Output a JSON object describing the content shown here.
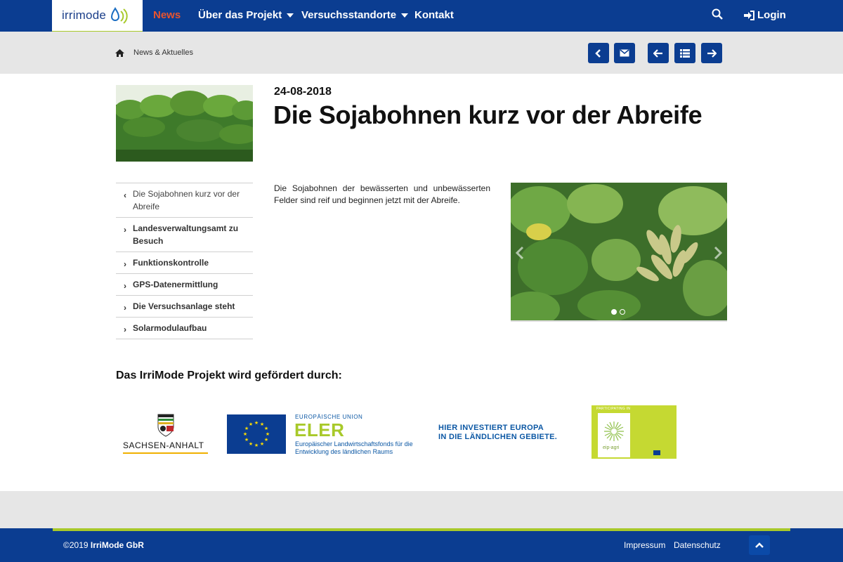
{
  "header": {
    "logo_text": "irrimode",
    "nav": [
      {
        "label": "News"
      },
      {
        "label": "Über das Projekt"
      },
      {
        "label": "Versuchsstandorte"
      },
      {
        "label": "Kontakt"
      }
    ],
    "login_label": "Login",
    "icons": {
      "search": "search-icon",
      "login": "sign-in-icon"
    },
    "colors": {
      "primary": "#0b3d91",
      "accent": "#a8c92a",
      "active": "#e8542e"
    }
  },
  "breadcrumb": {
    "label": "News & Aktuelles",
    "icons": [
      "home-icon"
    ]
  },
  "toolbar": {
    "buttons": [
      "chevron-left-icon",
      "envelope-icon",
      "arrow-left-icon",
      "list-icon",
      "arrow-right-icon"
    ]
  },
  "article": {
    "date": "24-08-2018",
    "title": "Die Sojabohnen kurz vor der Abreife",
    "body": "Die Sojabohnen der bewässerten und unbewässerten Felder sind reif und beginnen jetzt mit der Abreife."
  },
  "sidebar": {
    "items": [
      {
        "label": "Die Sojabohnen kurz vor der Abreife",
        "current": true
      },
      {
        "label": "Landesverwaltungsamt zu Besuch"
      },
      {
        "label": "Funktionskontrolle"
      },
      {
        "label": "GPS-Datenermittlung"
      },
      {
        "label": "Die Versuchsanlage steht"
      },
      {
        "label": "Solarmodulaufbau"
      }
    ]
  },
  "slider": {
    "slide_count": 2,
    "active_slide": 1
  },
  "sponsors": {
    "heading": "Das IrriMode Projekt wird gefördert durch:",
    "sachsen": "SACHSEN-ANHALT",
    "eu_small": "EUROPÄISCHE UNION",
    "eler": "ELER",
    "eler_sub": "Europäischer Landwirtschaftsfonds für die Entwicklung des ländlichen Raums",
    "investiert_line1": "HIER INVESTIERT EUROPA",
    "investiert_line2": "IN DIE LÄNDLICHEN GEBIETE.",
    "eip_tag": "PARTICIPATING IN",
    "eip_logo": "eip-agri"
  },
  "footer": {
    "copyright_prefix": "©2019 ",
    "company": "IrriMode GbR",
    "links": [
      {
        "label": "Impressum"
      },
      {
        "label": "Datenschutz"
      }
    ]
  }
}
